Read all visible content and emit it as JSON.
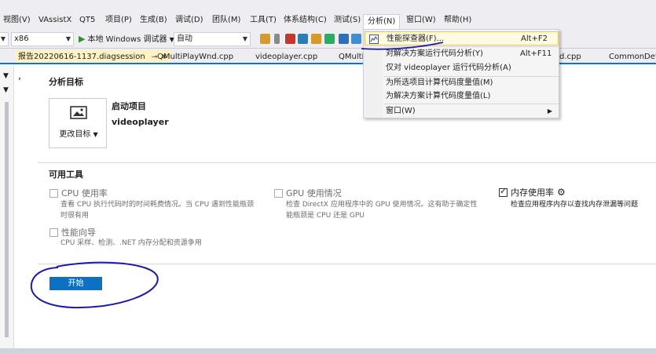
{
  "menu": {
    "items": [
      "视图(V)",
      "VAssistX",
      "QT5",
      "项目(P)",
      "生成(B)",
      "调试(D)",
      "团队(M)",
      "工具(T)",
      "体系结构(C)",
      "测试(S)",
      "分析(N)",
      "窗口(W)",
      "帮助(H)"
    ],
    "active": "分析(N)"
  },
  "toolbar": {
    "platform": "x86",
    "debugger": "本地 Windows 调试器",
    "config": "自动"
  },
  "tabs": {
    "active": "报告20220616-1137.diagsession",
    "items": [
      "QMultiPlayWnd.cpp",
      "videoplayer.cpp",
      "QMulti",
      "d.cpp",
      "CommonDefi"
    ]
  },
  "main": {
    "target_title": "分析目标",
    "change_target": "更改目标",
    "startup_label": "启动项目",
    "startup_project": "videoplayer",
    "tools_title": "可用工具",
    "tools": [
      {
        "name": "CPU 使用率",
        "checked": false,
        "desc": [
          "查看 CPU 执行代码时的时间耗费情况。当 CPU 遇到性能瓶颈",
          "时很有用"
        ]
      },
      {
        "name": "GPU 使用情况",
        "checked": false,
        "desc": [
          "检查 DirectX 应用程序中的 GPU 使用情况。这有助于确定性",
          "能瓶颈是 CPU 还是 GPU"
        ]
      },
      {
        "name": "内存使用率",
        "checked": true,
        "desc": [
          "检查应用程序内存以查找内存泄漏等问题"
        ]
      },
      {
        "name": "性能向导",
        "checked": false,
        "desc": [
          "CPU 采样、检测、.NET 内存分配和资源争用"
        ]
      }
    ],
    "start_button": "开始"
  },
  "dropdown": {
    "items": [
      {
        "label": "性能探查器(F)...",
        "shortcut": "Alt+F2"
      },
      {
        "label": "对解决方案运行代码分析(Y)",
        "shortcut": "Alt+F11"
      },
      {
        "label": "仅对 videoplayer 运行代码分析(A)",
        "shortcut": ""
      },
      {
        "label": "为所选项目计算代码度量值(M)",
        "shortcut": ""
      },
      {
        "label": "为解决方案计算代码度量值(L)",
        "shortcut": ""
      },
      {
        "label": "窗口(W)",
        "shortcut": ""
      }
    ]
  },
  "colors": {
    "accent": "#007acc",
    "start_button": "#0e70c0",
    "annotation": "#1a1aa6"
  }
}
